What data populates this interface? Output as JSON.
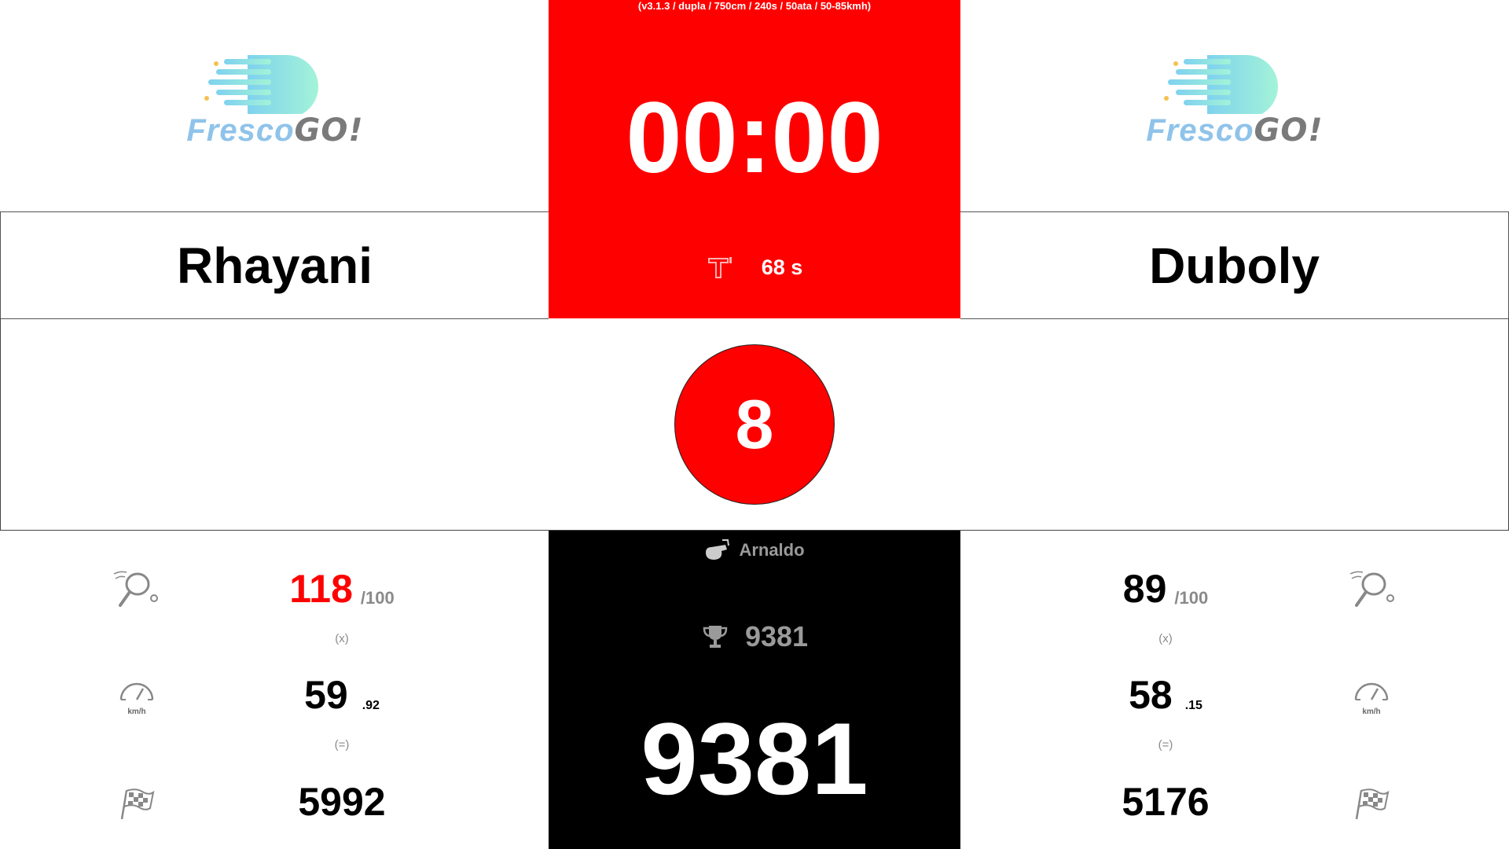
{
  "header": {
    "version": "(v3.1.3 / dupla / 750cm / 240s / 50ata / 50-85kmh)",
    "timer": "00:00",
    "rest_time": "68 s"
  },
  "logo": {
    "part1": "Fresco",
    "part2": "GO!"
  },
  "players": {
    "left": {
      "name": "Rhayani",
      "hits": "118",
      "hits_max": "/100",
      "op_x": "(x)",
      "speed_int": "59",
      "speed_dec": ".92",
      "op_eq": "(=)",
      "points": "5992",
      "speed_unit": "km/h"
    },
    "right": {
      "name": "Duboly",
      "hits": "89",
      "hits_max": "/100",
      "op_x": "(x)",
      "speed_int": "58",
      "speed_dec": ".15",
      "op_eq": "(=)",
      "points": "5176",
      "speed_unit": "km/h"
    }
  },
  "round": "8",
  "referee": "Arnaldo",
  "record": "9381",
  "total_score": "9381",
  "colors": {
    "accent": "#ff0000",
    "background_dark": "#000000",
    "muted": "#8a8a8a",
    "logo_blue": "#8fc3ea",
    "logo_teal": "#9ef0d6"
  },
  "icons": [
    "fresco-go-logo",
    "timer-icon",
    "racket-icon",
    "speedometer-icon",
    "checkered-flag-icon",
    "whistle-icon",
    "trophy-icon"
  ]
}
